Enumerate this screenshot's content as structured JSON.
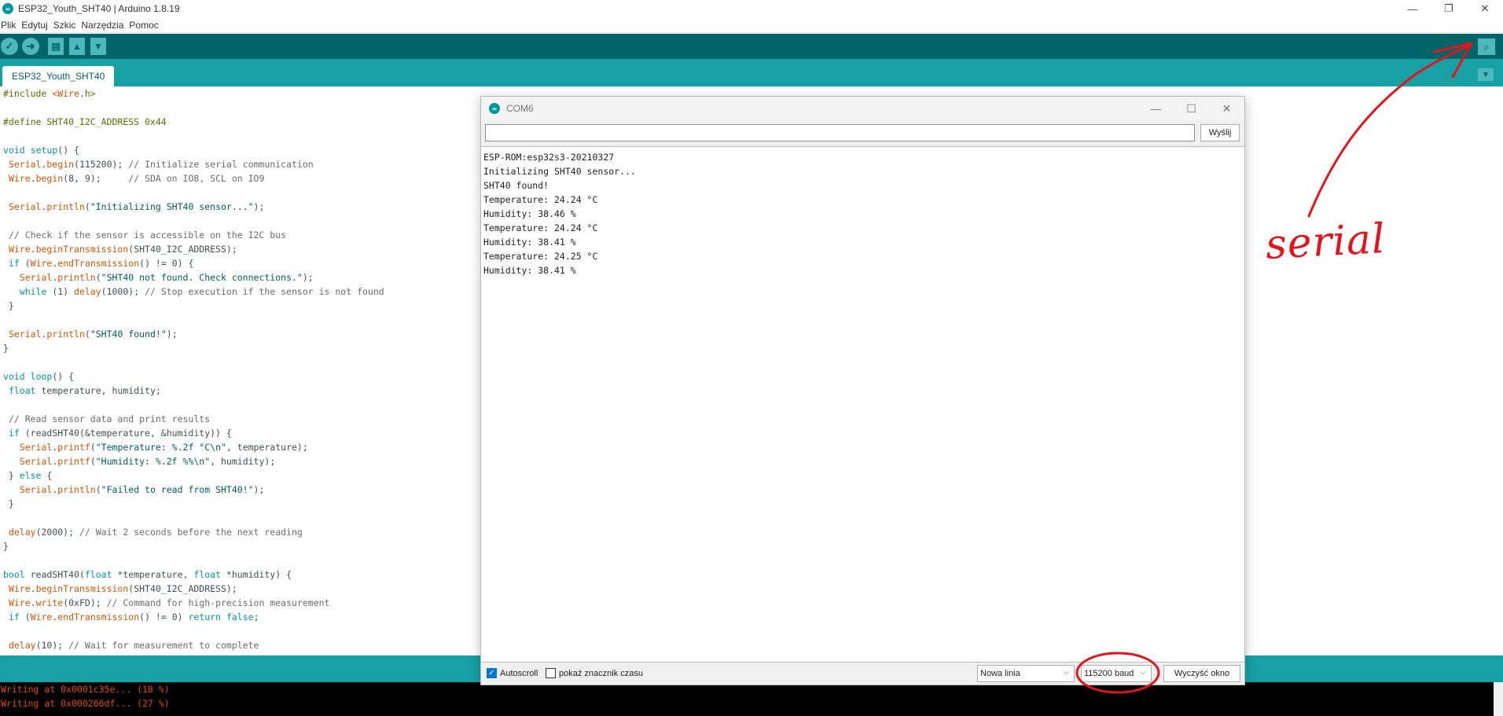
{
  "window": {
    "title": "ESP32_Youth_SHT40 | Arduino 1.8.19",
    "minimize": "—",
    "maximize": "❐",
    "close": "✕"
  },
  "menu": [
    "Plik",
    "Edytuj",
    "Szkic",
    "Narzędzia",
    "Pomoc"
  ],
  "toolbar": {
    "verify_icon": "✓",
    "upload_icon": "➜",
    "new_icon": "▤",
    "open_icon": "▲",
    "save_icon": "▼",
    "serial_icon": "⌕"
  },
  "tabs": {
    "active": "ESP32_Youth_SHT40",
    "menu_icon": "▼"
  },
  "code": [
    [
      [
        "pp",
        "#include "
      ],
      [
        "fn",
        "<Wire"
      ],
      [
        "",
        "."
      ],
      [
        "pp",
        "h>"
      ]
    ],
    [],
    [
      [
        "pp",
        "#define SHT40_I2C_ADDRESS 0x44"
      ]
    ],
    [],
    [
      [
        "kw",
        "void"
      ],
      [
        "",
        " "
      ],
      [
        "kw",
        "setup"
      ],
      [
        "",
        "() {"
      ]
    ],
    [
      [
        "",
        " "
      ],
      [
        "fn",
        "Serial"
      ],
      [
        "",
        "."
      ],
      [
        "fn",
        "begin"
      ],
      [
        "",
        "(115200); "
      ],
      [
        "cm",
        "// Initialize serial communication"
      ]
    ],
    [
      [
        "",
        " "
      ],
      [
        "fn",
        "Wire"
      ],
      [
        "",
        "."
      ],
      [
        "fn",
        "begin"
      ],
      [
        "",
        "(8, 9);     "
      ],
      [
        "cm",
        "// SDA on IO8, SCL on IO9"
      ]
    ],
    [],
    [
      [
        "",
        " "
      ],
      [
        "fn",
        "Serial"
      ],
      [
        "",
        "."
      ],
      [
        "fn",
        "println"
      ],
      [
        "",
        "("
      ],
      [
        "st",
        "\"Initializing SHT40 sensor...\""
      ],
      [
        "",
        ");"
      ]
    ],
    [],
    [
      [
        "",
        " "
      ],
      [
        "cm",
        "// Check if the sensor is accessible on the I2C bus"
      ]
    ],
    [
      [
        "",
        " "
      ],
      [
        "fn",
        "Wire"
      ],
      [
        "",
        "."
      ],
      [
        "fn",
        "beginTransmission"
      ],
      [
        "",
        "(SHT40_I2C_ADDRESS);"
      ]
    ],
    [
      [
        "",
        " "
      ],
      [
        "kw",
        "if"
      ],
      [
        "",
        " ("
      ],
      [
        "fn",
        "Wire"
      ],
      [
        "",
        "."
      ],
      [
        "fn",
        "endTransmission"
      ],
      [
        "",
        "() != 0) {"
      ]
    ],
    [
      [
        "",
        "   "
      ],
      [
        "fn",
        "Serial"
      ],
      [
        "",
        "."
      ],
      [
        "fn",
        "println"
      ],
      [
        "",
        "("
      ],
      [
        "st",
        "\"SHT40 not found. Check connections.\""
      ],
      [
        "",
        ");"
      ]
    ],
    [
      [
        "",
        "   "
      ],
      [
        "kw",
        "while"
      ],
      [
        "",
        " (1) "
      ],
      [
        "fn",
        "delay"
      ],
      [
        "",
        "(1000); "
      ],
      [
        "cm",
        "// Stop execution if the sensor is not found"
      ]
    ],
    [
      [
        "",
        " }"
      ]
    ],
    [],
    [
      [
        "",
        " "
      ],
      [
        "fn",
        "Serial"
      ],
      [
        "",
        "."
      ],
      [
        "fn",
        "println"
      ],
      [
        "",
        "("
      ],
      [
        "st",
        "\"SHT40 found!\""
      ],
      [
        "",
        ");"
      ]
    ],
    [
      [
        "",
        "}"
      ]
    ],
    [],
    [
      [
        "kw",
        "void"
      ],
      [
        "",
        " "
      ],
      [
        "kw",
        "loop"
      ],
      [
        "",
        "() {"
      ]
    ],
    [
      [
        "",
        " "
      ],
      [
        "kw",
        "float"
      ],
      [
        "",
        " temperature, humidity;"
      ]
    ],
    [],
    [
      [
        "",
        " "
      ],
      [
        "cm",
        "// Read sensor data and print results"
      ]
    ],
    [
      [
        "",
        " "
      ],
      [
        "kw",
        "if"
      ],
      [
        "",
        " (readSHT40(&temperature, &humidity)) {"
      ]
    ],
    [
      [
        "",
        "   "
      ],
      [
        "fn",
        "Serial"
      ],
      [
        "",
        "."
      ],
      [
        "fn",
        "printf"
      ],
      [
        "",
        "("
      ],
      [
        "st",
        "\"Temperature: %.2f °C\\n\""
      ],
      [
        "",
        ", temperature);"
      ]
    ],
    [
      [
        "",
        "   "
      ],
      [
        "fn",
        "Serial"
      ],
      [
        "",
        "."
      ],
      [
        "fn",
        "printf"
      ],
      [
        "",
        "("
      ],
      [
        "st",
        "\"Humidity: %.2f %%\\n\""
      ],
      [
        "",
        ", humidity);"
      ]
    ],
    [
      [
        "",
        " } "
      ],
      [
        "kw",
        "else"
      ],
      [
        "",
        " {"
      ]
    ],
    [
      [
        "",
        "   "
      ],
      [
        "fn",
        "Serial"
      ],
      [
        "",
        "."
      ],
      [
        "fn",
        "println"
      ],
      [
        "",
        "("
      ],
      [
        "st",
        "\"Failed to read from SHT40!\""
      ],
      [
        "",
        ");"
      ]
    ],
    [
      [
        "",
        " }"
      ]
    ],
    [],
    [
      [
        "",
        " "
      ],
      [
        "fn",
        "delay"
      ],
      [
        "",
        "(2000); "
      ],
      [
        "cm",
        "// Wait 2 seconds before the next reading"
      ]
    ],
    [
      [
        "",
        "}"
      ]
    ],
    [],
    [
      [
        "kw",
        "bool"
      ],
      [
        "",
        " readSHT40("
      ],
      [
        "kw",
        "float"
      ],
      [
        "",
        " *temperature, "
      ],
      [
        "kw",
        "float"
      ],
      [
        "",
        " *humidity) {"
      ]
    ],
    [
      [
        "",
        " "
      ],
      [
        "fn",
        "Wire"
      ],
      [
        "",
        "."
      ],
      [
        "fn",
        "beginTransmission"
      ],
      [
        "",
        "(SHT40_I2C_ADDRESS);"
      ]
    ],
    [
      [
        "",
        " "
      ],
      [
        "fn",
        "Wire"
      ],
      [
        "",
        "."
      ],
      [
        "fn",
        "write"
      ],
      [
        "",
        "(0xFD); "
      ],
      [
        "cm",
        "// Command for high-precision measurement"
      ]
    ],
    [
      [
        "",
        " "
      ],
      [
        "kw",
        "if"
      ],
      [
        "",
        " ("
      ],
      [
        "fn",
        "Wire"
      ],
      [
        "",
        "."
      ],
      [
        "fn",
        "endTransmission"
      ],
      [
        "",
        "() != 0) "
      ],
      [
        "kw",
        "return"
      ],
      [
        "",
        " "
      ],
      [
        "kw",
        "false"
      ],
      [
        "",
        ";"
      ]
    ],
    [],
    [
      [
        "",
        " "
      ],
      [
        "fn",
        "delay"
      ],
      [
        "",
        "(10); "
      ],
      [
        "cm",
        "// Wait for measurement to complete"
      ]
    ]
  ],
  "console": [
    "Writing at 0x0001c35e... (18 %)",
    "Writing at 0x000266df... (27 %)"
  ],
  "serial_monitor": {
    "title": "COM6",
    "input_value": "",
    "send_label": "Wyślij",
    "output": [
      "ESP-ROM:esp32s3-20210327",
      "Initializing SHT40 sensor...",
      "SHT40 found!",
      "Temperature: 24.24 °C",
      "Humidity: 38.46 %",
      "Temperature: 24.24 °C",
      "Humidity: 38.41 %",
      "Temperature: 24.25 °C",
      "Humidity: 38.41 %"
    ],
    "autoscroll_label": "Autoscroll",
    "autoscroll_checked": true,
    "timestamp_label": "pokaż znacznik czasu",
    "timestamp_checked": false,
    "line_ending": "Nowa linia",
    "baud_rate": "115200 baud",
    "clear_label": "Wyczyść okno"
  },
  "annotation": {
    "text": "serial",
    "color": "#e3141b"
  },
  "colors": {
    "toolbar": "#006468",
    "tabbar": "#17a1a5",
    "button": "#4db7bb"
  }
}
